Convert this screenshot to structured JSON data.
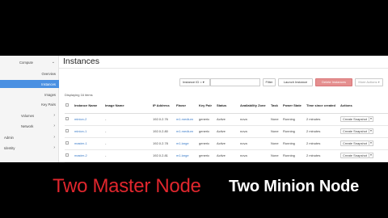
{
  "sidebar": {
    "items": [
      {
        "label": "Compute",
        "chevron": "⌄"
      },
      {
        "label": "Overview"
      },
      {
        "label": "Instances"
      },
      {
        "label": "Images"
      },
      {
        "label": "Key Pairs"
      },
      {
        "label": "Volumes",
        "chevron": "›"
      },
      {
        "label": "Network",
        "chevron": "›"
      },
      {
        "label": "Admin",
        "chevron": "›"
      },
      {
        "label": "Identity",
        "chevron": "›"
      }
    ]
  },
  "page": {
    "title": "Instances",
    "filter_select": "Instance ID = ▾",
    "filter_button": "Filter",
    "launch_button": "Launch Instance",
    "delete_button": "Delete Instances",
    "more_button": "More Actions ▾",
    "count_text": "Displaying 16 items"
  },
  "table": {
    "headers": [
      "Instance Name",
      "Image Name",
      "IP Address",
      "Flavor",
      "Key Pair",
      "Status",
      "Availability Zone",
      "Task",
      "Power State",
      "Time since created",
      "Actions"
    ],
    "rows": [
      {
        "name": "minion-2",
        "image": "-",
        "ip": "192.0.2.76",
        "flavor": "m1.medium",
        "key": "generic",
        "status": "Active",
        "zone": "nova",
        "task": "None",
        "power": "Running",
        "time": "2 minutes",
        "action": "Create Snapshot"
      },
      {
        "name": "minion-1",
        "image": "-",
        "ip": "192.0.2.80",
        "flavor": "m1.medium",
        "key": "generic",
        "status": "Active",
        "zone": "nova",
        "task": "None",
        "power": "Running",
        "time": "2 minutes",
        "action": "Create Snapshot"
      },
      {
        "name": "master-1",
        "image": "-",
        "ip": "192.0.2.78",
        "flavor": "m1.large",
        "key": "generic",
        "status": "Active",
        "zone": "nova",
        "task": "None",
        "power": "Running",
        "time": "2 minutes",
        "action": "Create Snapshot"
      },
      {
        "name": "master-2",
        "image": "-",
        "ip": "192.0.2.81",
        "flavor": "m1.large",
        "key": "generic",
        "status": "Active",
        "zone": "nova",
        "task": "None",
        "power": "Running",
        "time": "2 minutes",
        "action": "Create Snapshot"
      }
    ]
  },
  "caption": {
    "red": "Two Master Node",
    "white": "Two Minion Node"
  },
  "colors": {
    "accent": "#4a90e2",
    "danger": "#e58f8f",
    "caption_red": "#e0262d"
  }
}
